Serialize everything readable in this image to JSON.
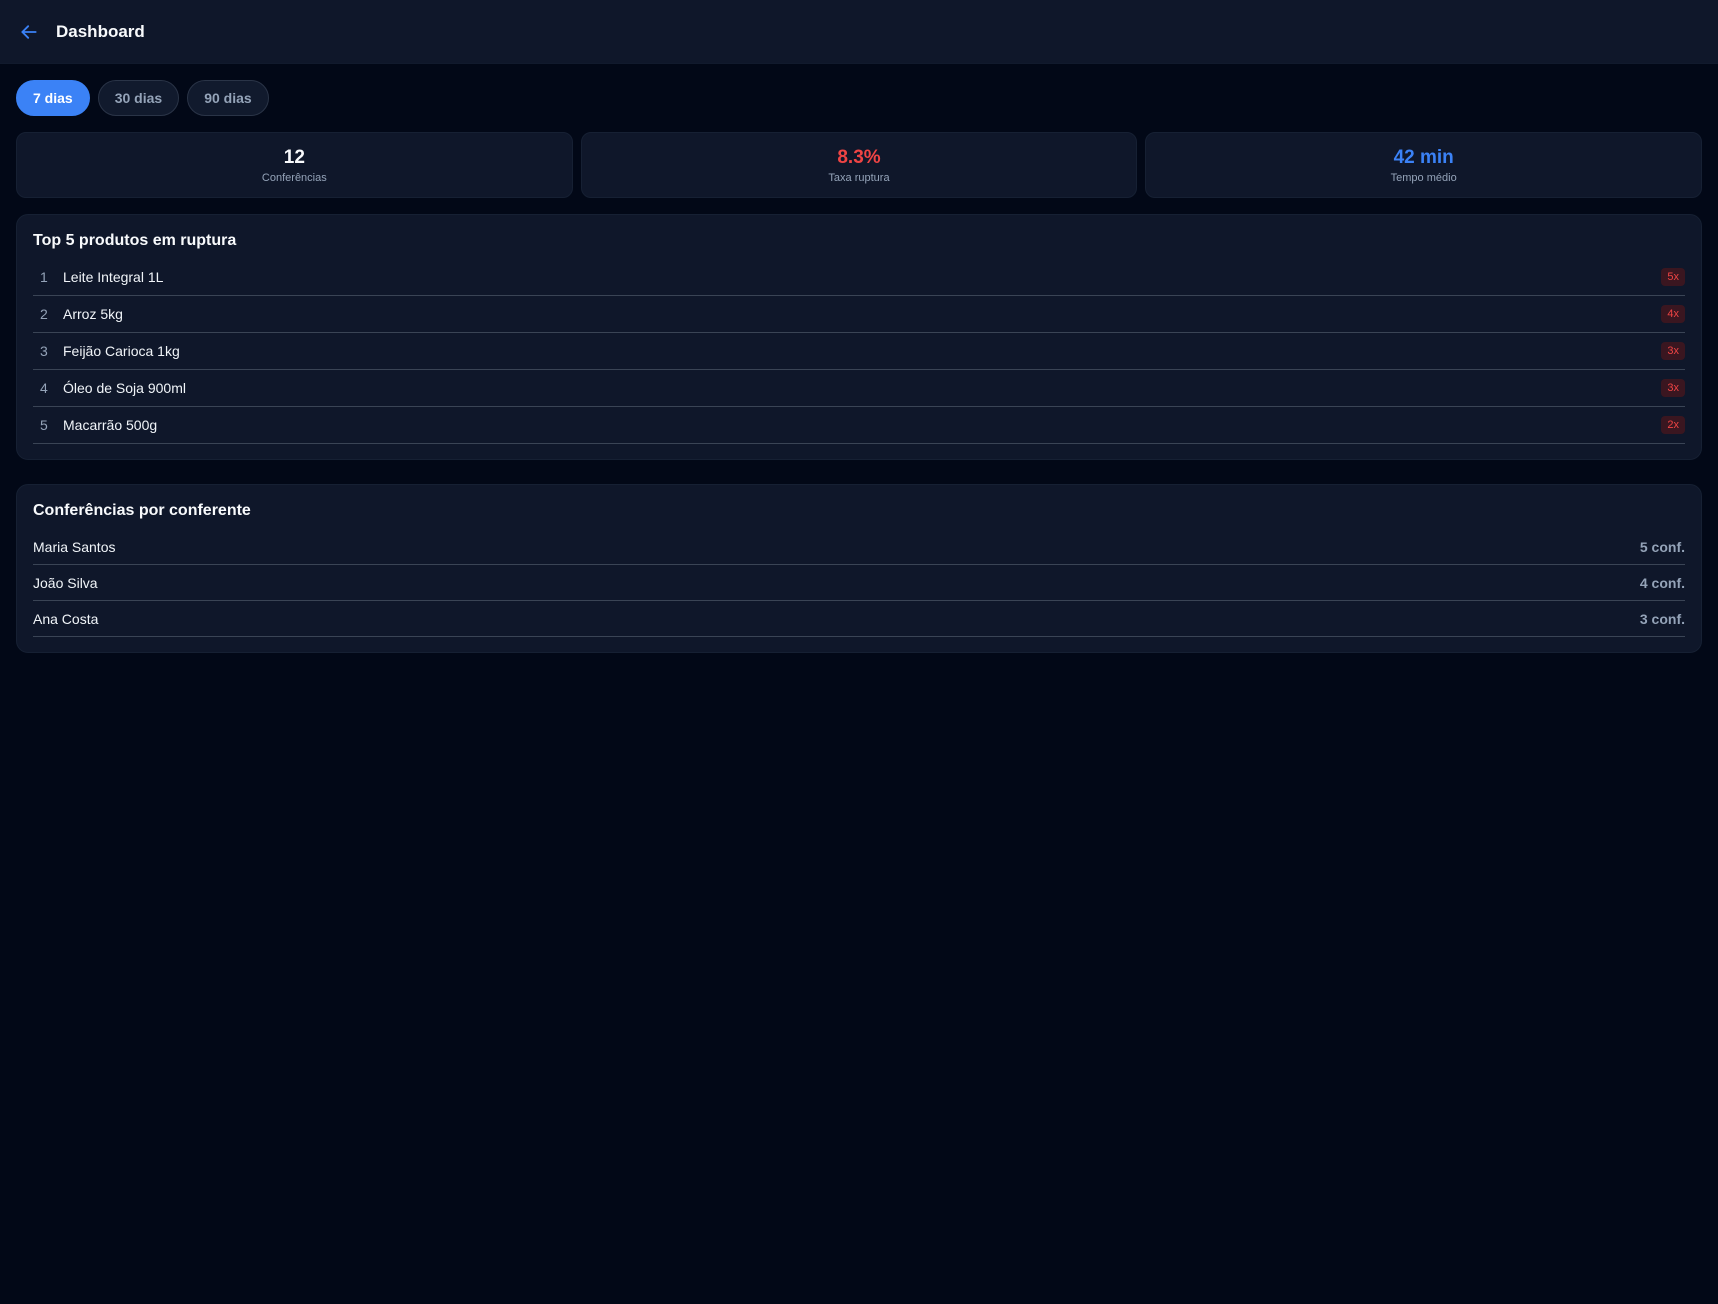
{
  "header": {
    "title": "Dashboard",
    "back_icon": "arrow-left-icon",
    "accent": "#3b82f6"
  },
  "periods": [
    {
      "label": "7 dias",
      "active": true
    },
    {
      "label": "30 dias",
      "active": false
    },
    {
      "label": "90 dias",
      "active": false
    }
  ],
  "stats": [
    {
      "value": "12",
      "label": "Conferências",
      "color": "#f8fafc"
    },
    {
      "value": "8.3%",
      "label": "Taxa ruptura",
      "color": "#ef4444"
    },
    {
      "value": "42 min",
      "label": "Tempo médio",
      "color": "#3b82f6"
    }
  ],
  "top_products": {
    "title": "Top 5 produtos em ruptura",
    "items": [
      {
        "rank": "1",
        "name": "Leite Integral 1L",
        "count": "5x"
      },
      {
        "rank": "2",
        "name": "Arroz 5kg",
        "count": "4x"
      },
      {
        "rank": "3",
        "name": "Feijão Carioca 1kg",
        "count": "3x"
      },
      {
        "rank": "4",
        "name": "Óleo de Soja 900ml",
        "count": "3x"
      },
      {
        "rank": "5",
        "name": "Macarrão 500g",
        "count": "2x"
      }
    ]
  },
  "by_checker": {
    "title": "Conferências por conferente",
    "items": [
      {
        "name": "Maria Santos",
        "count": "5 conf."
      },
      {
        "name": "João Silva",
        "count": "4 conf."
      },
      {
        "name": "Ana Costa",
        "count": "3 conf."
      }
    ]
  }
}
